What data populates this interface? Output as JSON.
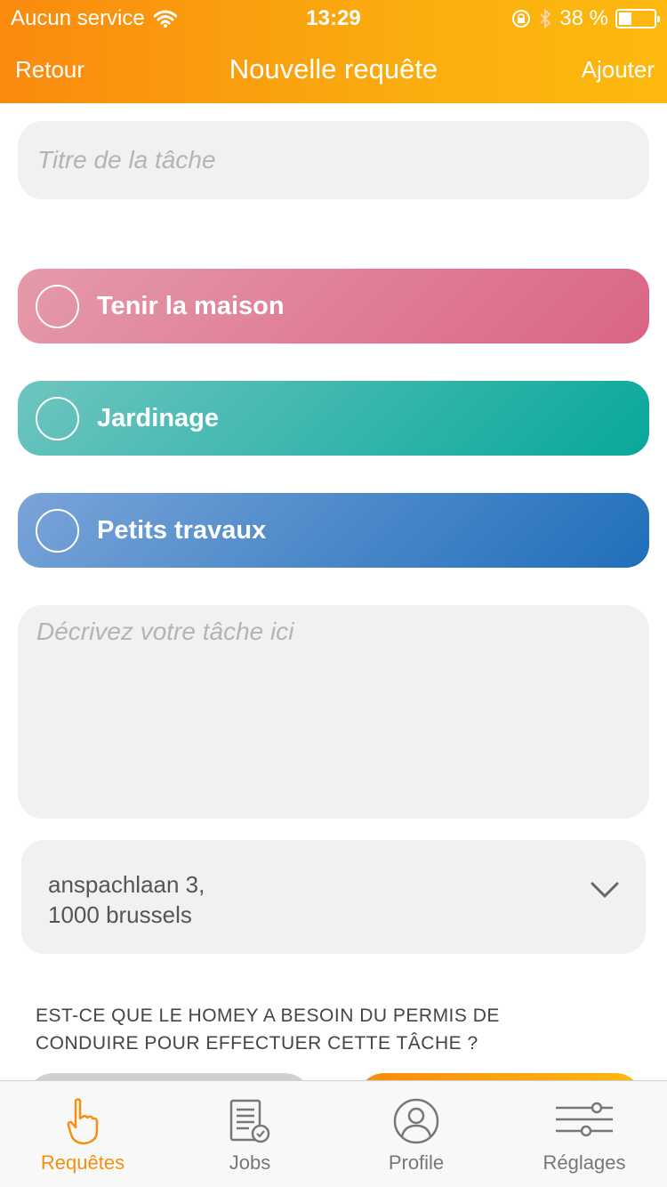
{
  "status_bar": {
    "carrier": "Aucun service",
    "time": "13:29",
    "battery": "38 %",
    "battery_level": 0.38
  },
  "nav": {
    "back_label": "Retour",
    "title": "Nouvelle requête",
    "add_label": "Ajouter"
  },
  "form": {
    "title_placeholder": "Titre de la tâche",
    "description_placeholder": "Décrivez votre tâche ici",
    "categories": [
      {
        "label": "Tenir la maison",
        "selected": false,
        "color": "#e07a93"
      },
      {
        "label": "Jardinage",
        "selected": false,
        "color": "#3bb8ad"
      },
      {
        "label": "Petits travaux",
        "selected": false,
        "color": "#4a86c8"
      }
    ],
    "address_line1": "anspachlaan  3,",
    "address_line2": "1000 brussels",
    "license_question_line1": "EST-CE QUE LE HOMEY A BESOIN DU PERMIS DE",
    "license_question_line2": "CONDUIRE POUR EFFECTUER CETTE TÂCHE ?"
  },
  "tabbar": {
    "tabs": [
      {
        "label": "Requêtes",
        "icon": "hand-pointer-icon",
        "active": true
      },
      {
        "label": "Jobs",
        "icon": "document-check-icon",
        "active": false
      },
      {
        "label": "Profile",
        "icon": "user-circle-icon",
        "active": false
      },
      {
        "label": "Réglages",
        "icon": "sliders-icon",
        "active": false
      }
    ]
  },
  "colors": {
    "accent": "#f5900e",
    "header_start": "#f98a0e",
    "header_end": "#fdb90f"
  }
}
